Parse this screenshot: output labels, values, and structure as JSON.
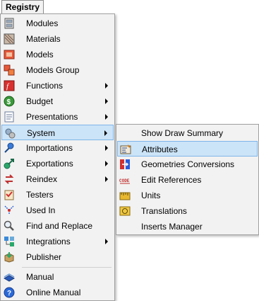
{
  "menubar": {
    "title": "Registry"
  },
  "main_menu": {
    "items": [
      {
        "label": "Modules",
        "icon": "modules-icon"
      },
      {
        "label": "Materials",
        "icon": "materials-icon"
      },
      {
        "label": "Models",
        "icon": "models-icon"
      },
      {
        "label": "Models Group",
        "icon": "models-group-icon"
      },
      {
        "label": "Functions",
        "icon": "functions-icon",
        "submenu": true
      },
      {
        "label": "Budget",
        "icon": "budget-icon",
        "submenu": true
      },
      {
        "label": "Presentations",
        "icon": "presentations-icon",
        "submenu": true
      },
      {
        "label": "System",
        "icon": "system-icon",
        "submenu": true,
        "highlighted": true
      },
      {
        "label": "Importations",
        "icon": "importations-icon",
        "submenu": true
      },
      {
        "label": "Exportations",
        "icon": "exportations-icon",
        "submenu": true
      },
      {
        "label": "Reindex",
        "icon": "reindex-icon",
        "submenu": true
      },
      {
        "label": "Testers",
        "icon": "testers-icon"
      },
      {
        "label": "Used In",
        "icon": "used-in-icon"
      },
      {
        "label": "Find and Replace",
        "icon": "find-replace-icon"
      },
      {
        "label": "Integrations",
        "icon": "integrations-icon",
        "submenu": true
      },
      {
        "label": "Publisher",
        "icon": "publisher-icon"
      },
      {
        "label": "Manual",
        "icon": "manual-icon"
      },
      {
        "label": "Online Manual",
        "icon": "online-manual-icon"
      }
    ]
  },
  "system_submenu": {
    "items": [
      {
        "label": "Show Draw Summary",
        "icon": ""
      },
      {
        "label": "Attributes",
        "icon": "attributes-icon",
        "highlighted": true
      },
      {
        "label": "Geometries Conversions",
        "icon": "geometries-conversions-icon"
      },
      {
        "label": "Edit References",
        "icon": "edit-references-icon"
      },
      {
        "label": "Units",
        "icon": "units-icon"
      },
      {
        "label": "Translations",
        "icon": "translations-icon"
      },
      {
        "label": "Inserts Manager",
        "icon": ""
      }
    ]
  },
  "colors": {
    "highlight_bg": "#cce4f7",
    "highlight_border": "#7eb4ea",
    "menu_bg": "#f2f2f2"
  }
}
